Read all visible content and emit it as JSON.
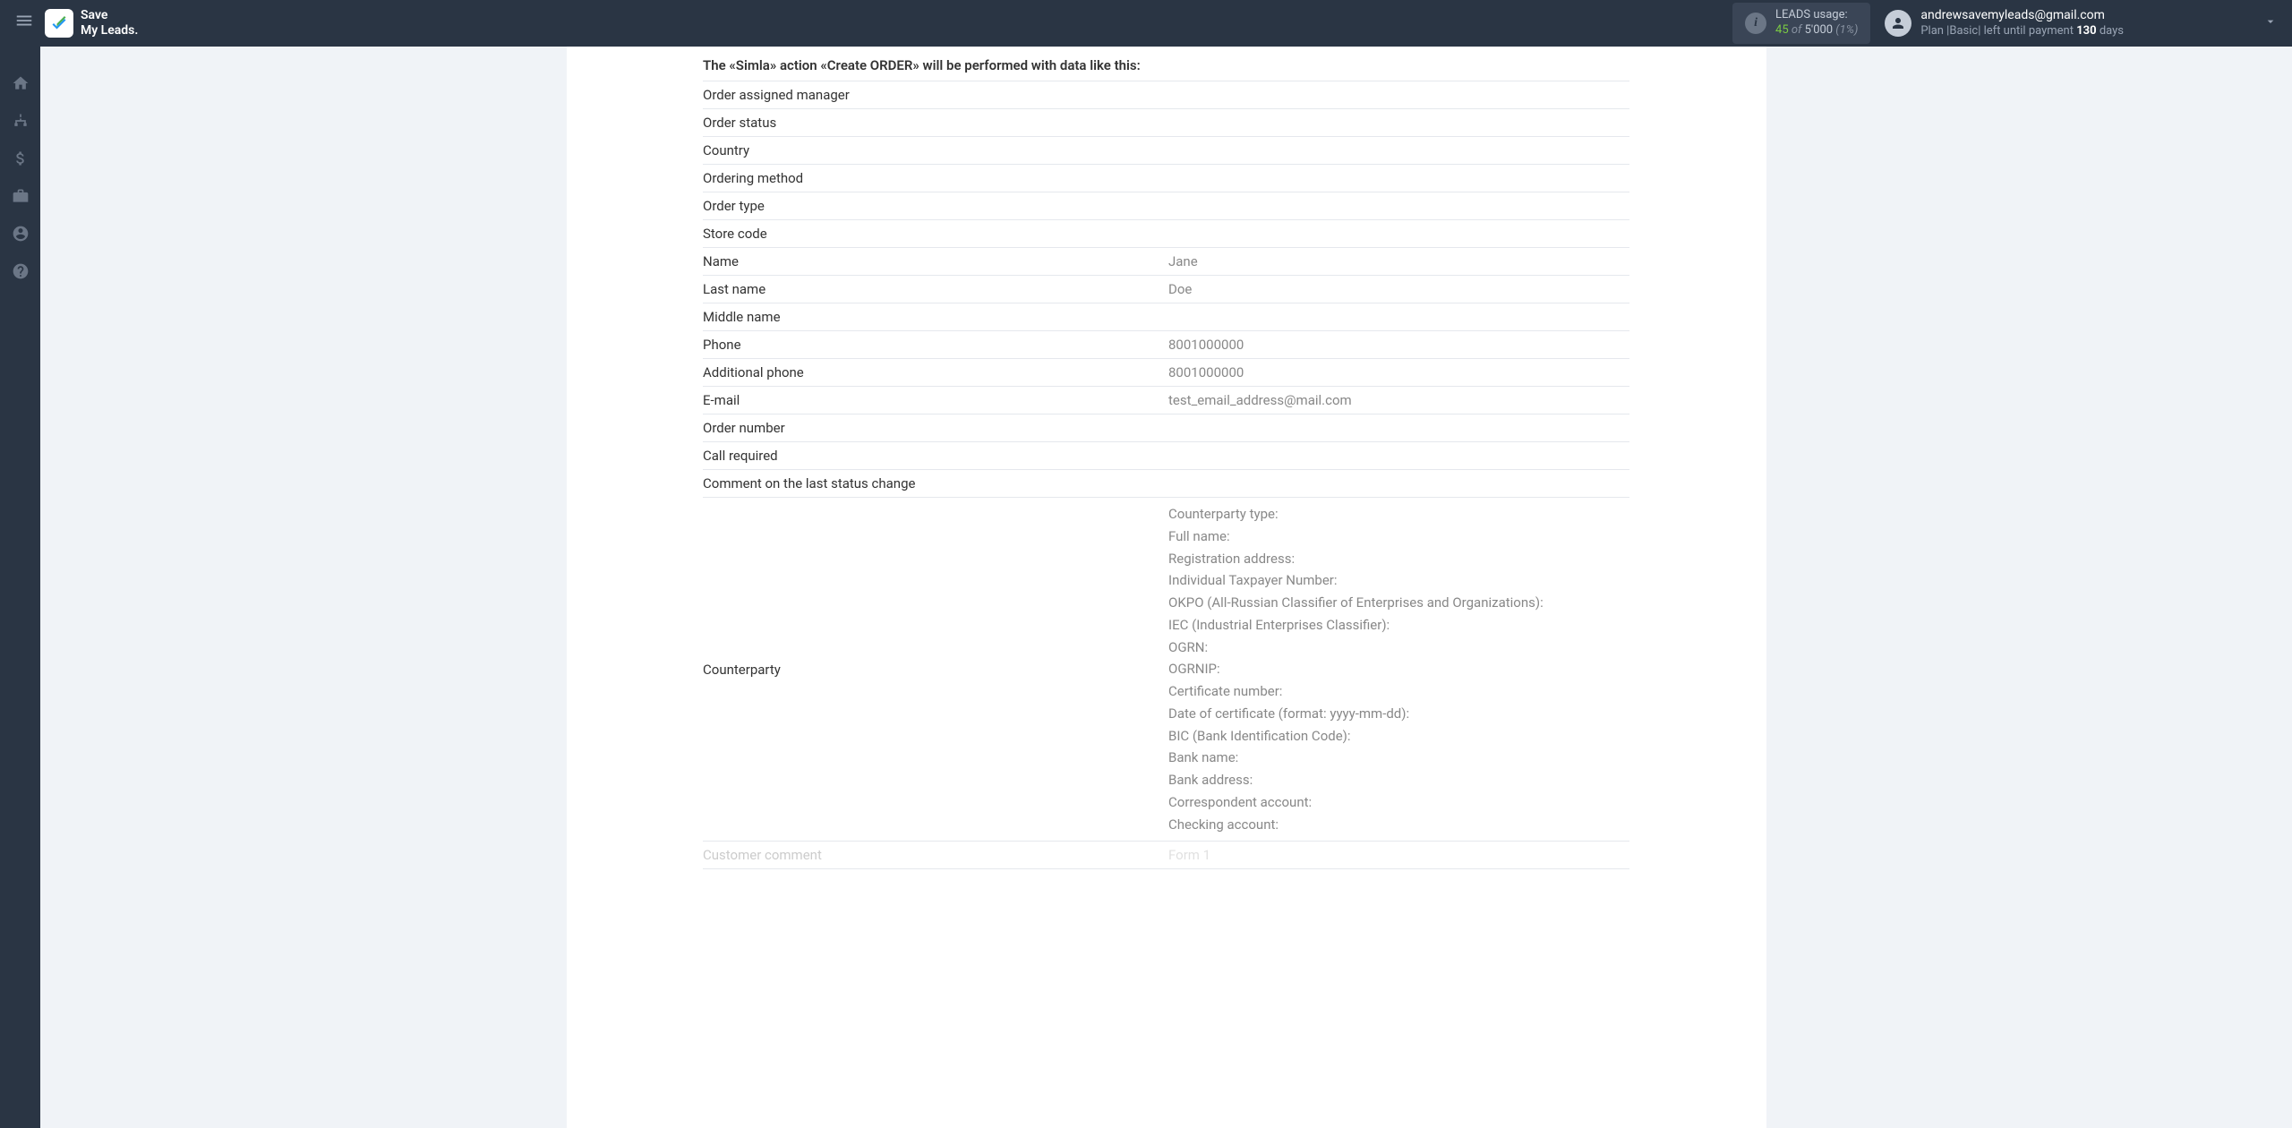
{
  "header": {
    "logo_line1": "Save",
    "logo_line2": "My Leads.",
    "leads_usage_label": "LEADS usage:",
    "leads_used": "45",
    "leads_of": " of ",
    "leads_total": "5'000",
    "leads_percent": " (1%)",
    "user_email": "andrewsavemyleads@gmail.com",
    "plan_prefix": "Plan |",
    "plan_name": "Basic",
    "plan_mid": "| left until payment ",
    "plan_days": "130",
    "plan_suffix": " days"
  },
  "section": {
    "title": "The «Simla» action «Create ORDER» will be performed with data like this:"
  },
  "rows": [
    {
      "label": "Order assigned manager",
      "value": ""
    },
    {
      "label": "Order status",
      "value": ""
    },
    {
      "label": "Country",
      "value": ""
    },
    {
      "label": "Ordering method",
      "value": ""
    },
    {
      "label": "Order type",
      "value": ""
    },
    {
      "label": "Store code",
      "value": ""
    },
    {
      "label": "Name",
      "value": "Jane"
    },
    {
      "label": "Last name",
      "value": "Doe"
    },
    {
      "label": "Middle name",
      "value": ""
    },
    {
      "label": "Phone",
      "value": "8001000000"
    },
    {
      "label": "Additional phone",
      "value": "8001000000"
    },
    {
      "label": "E-mail",
      "value": "test_email_address@mail.com"
    },
    {
      "label": "Order number",
      "value": ""
    },
    {
      "label": "Call required",
      "value": ""
    },
    {
      "label": "Comment on the last status change",
      "value": ""
    }
  ],
  "counterparty": {
    "label": "Counterparty",
    "lines": [
      "Counterparty type:",
      "Full name:",
      "Registration address:",
      "Individual Taxpayer Number:",
      "OKPO (All-Russian Classifier of Enterprises and Organizations):",
      "IEC (Industrial Enterprises Classifier):",
      "OGRN:",
      "OGRNIP:",
      "Certificate number:",
      "Date of certificate (format: yyyy-mm-dd):",
      "BIC (Bank Identification Code):",
      "Bank name:",
      "Bank address:",
      "Correspondent account:",
      "Checking account:"
    ]
  },
  "bottom_row": {
    "label": "Customer comment",
    "value": "Form 1"
  }
}
